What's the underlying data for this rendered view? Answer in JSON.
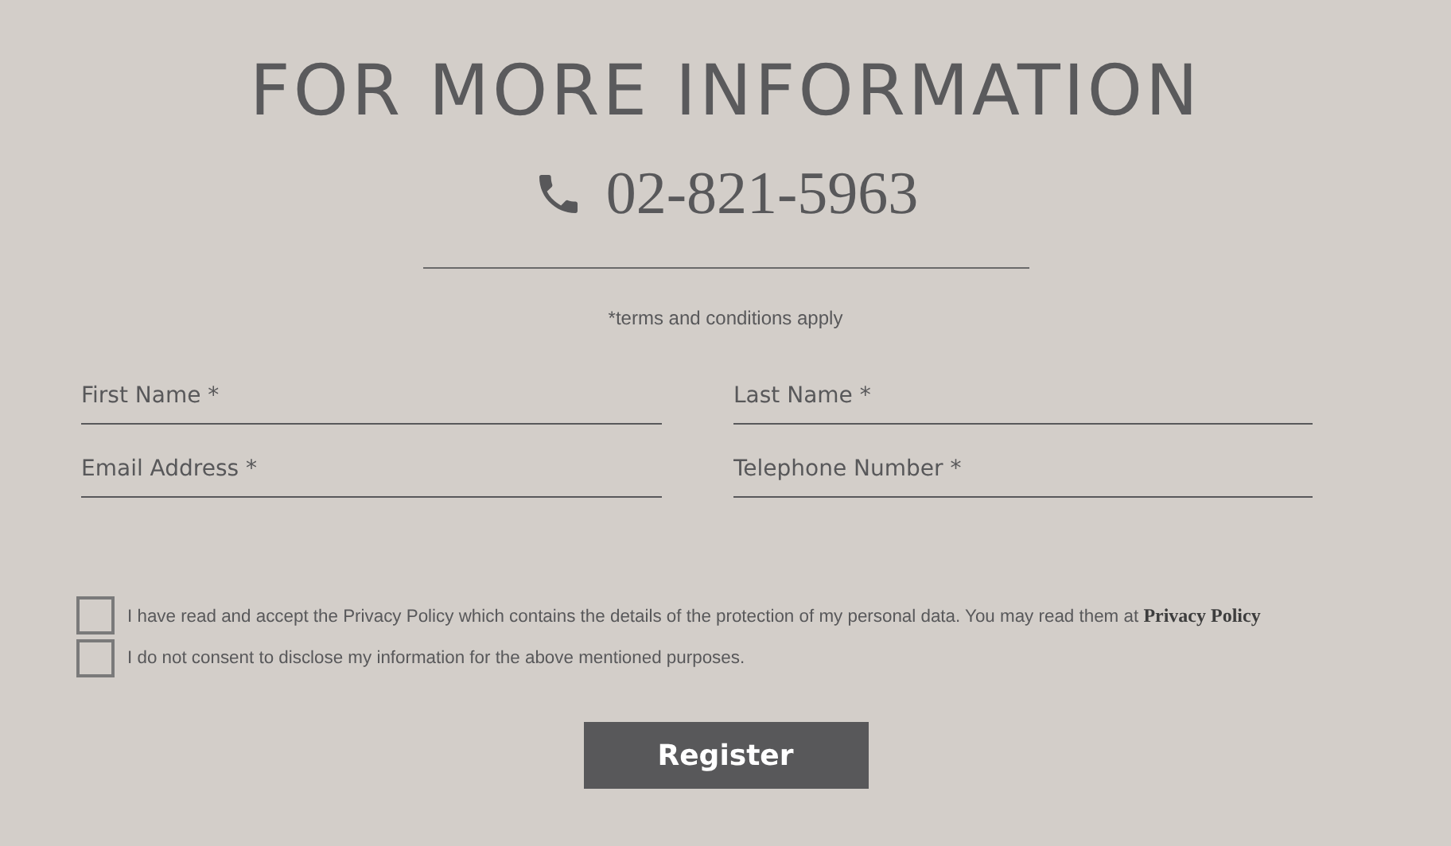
{
  "title": "FOR MORE INFORMATION",
  "phone": "02-821-5963",
  "terms_note": "*terms and conditions apply",
  "fields": [
    {
      "placeholder": "First Name *"
    },
    {
      "placeholder": "Last Name *"
    },
    {
      "placeholder": "Email Address *"
    },
    {
      "placeholder": "Telephone Number *"
    }
  ],
  "consents": [
    {
      "text": "I have read and accept the Privacy Policy which contains the details of the protection of my personal data. You may read them at ",
      "link": "Privacy Policy",
      "checked": false
    },
    {
      "text": "I do not consent to disclose my information for the above mentioned purposes.",
      "checked": false
    }
  ],
  "button": "Register"
}
